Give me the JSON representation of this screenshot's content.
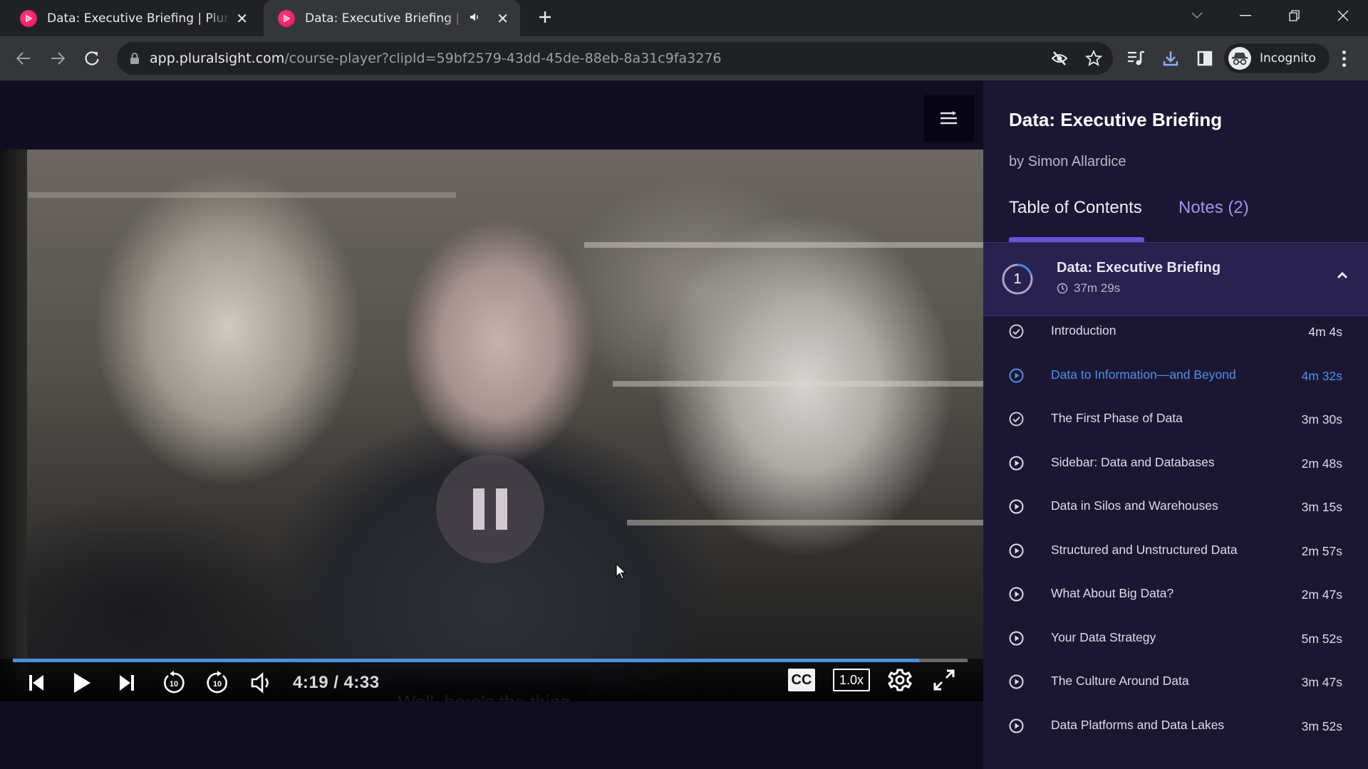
{
  "browser": {
    "tabs": [
      {
        "title": "Data: Executive Briefing | Pluralsight",
        "active": false,
        "audio": false
      },
      {
        "title": "Data: Executive Briefing | Pluralsight",
        "active": true,
        "audio": true
      }
    ],
    "url_host": "app.pluralsight.com",
    "url_path": "/course-player?clipId=59bf2579-43dd-45de-88eb-8a31c9fa3276",
    "profile_label": "Incognito",
    "icons": {
      "favicon": "pluralsight-play-icon",
      "close": "close-icon",
      "audio": "speaker-icon",
      "new_tab": "plus-icon"
    }
  },
  "player": {
    "caption": "Well, here's the thing.",
    "current_time": "4:19",
    "total_time": "4:33",
    "timecode": "4:19 / 4:33",
    "progress_fraction": 0.949,
    "buffered_fraction": 0.99,
    "state": "paused-overlay",
    "cc_label": "CC",
    "speed_label": "1.0x",
    "accent_color": "#4f8fe0"
  },
  "sidebar": {
    "course_title": "Data: Executive Briefing",
    "author": "by Simon Allardice",
    "tabs": [
      {
        "label": "Table of Contents",
        "active": true
      },
      {
        "label": "Notes (2)",
        "active": false
      }
    ],
    "module": {
      "number": "1",
      "title": "Data: Executive Briefing",
      "duration": "37m 29s",
      "progress_fraction": 0.2,
      "expanded": true
    },
    "clips": [
      {
        "title": "Introduction",
        "duration": "4m 4s",
        "status": "completed"
      },
      {
        "title": "Data to Information—and Beyond",
        "duration": "4m 32s",
        "status": "current"
      },
      {
        "title": "The First Phase of Data",
        "duration": "3m 30s",
        "status": "completed"
      },
      {
        "title": "Sidebar: Data and Databases",
        "duration": "2m 48s",
        "status": "unwatched"
      },
      {
        "title": "Data in Silos and Warehouses",
        "duration": "3m 15s",
        "status": "unwatched"
      },
      {
        "title": "Structured and Unstructured Data",
        "duration": "2m 57s",
        "status": "unwatched"
      },
      {
        "title": "What About Big Data?",
        "duration": "2m 47s",
        "status": "unwatched"
      },
      {
        "title": "Your Data Strategy",
        "duration": "5m 52s",
        "status": "unwatched"
      },
      {
        "title": "The Culture Around Data",
        "duration": "3m 47s",
        "status": "unwatched"
      },
      {
        "title": "Data Platforms and Data Lakes",
        "duration": "3m 52s",
        "status": "unwatched"
      }
    ],
    "colors": {
      "current": "#4f8fe8",
      "tab_accent": "#6a52d8",
      "notes_tab": "#9f94ef"
    }
  }
}
